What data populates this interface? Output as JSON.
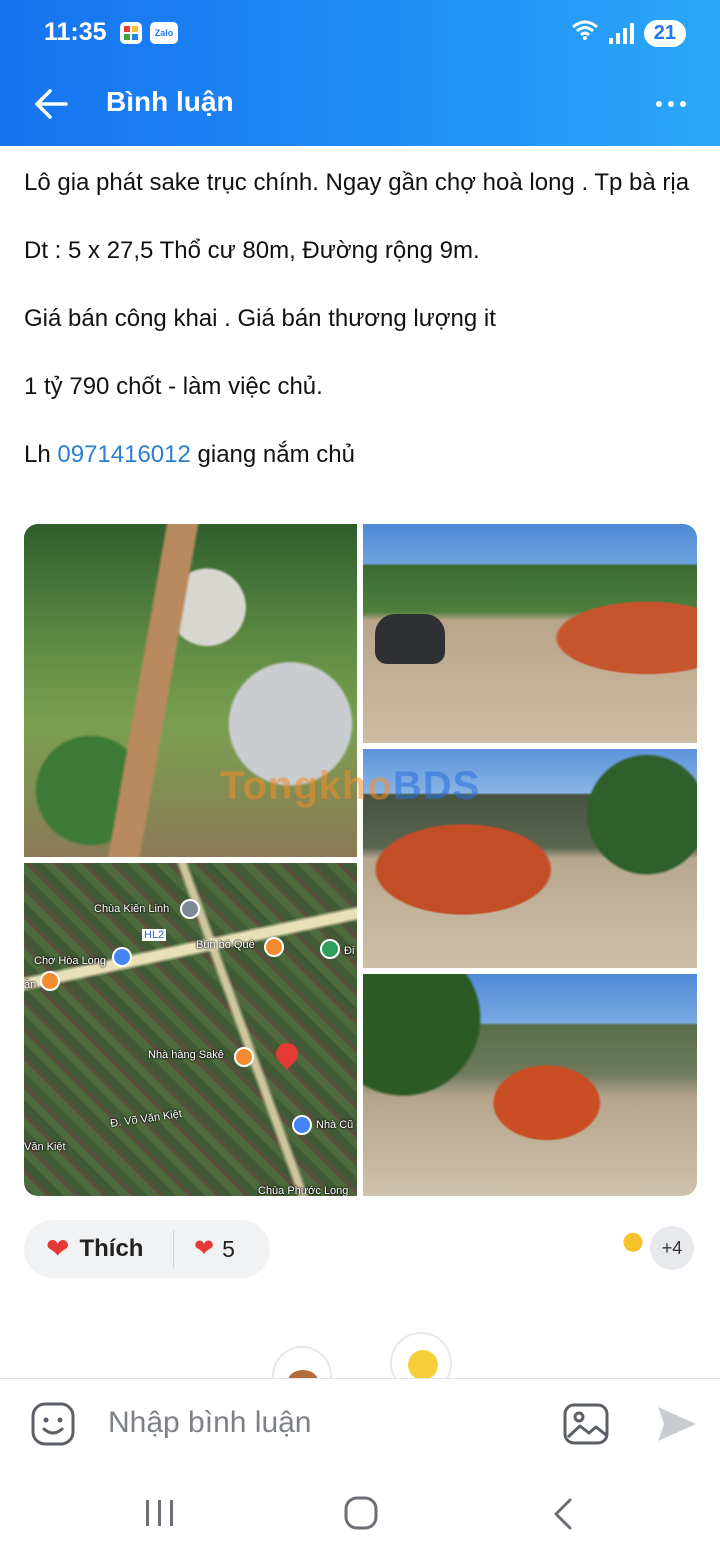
{
  "status_bar": {
    "time": "11:35",
    "app_icons": [
      "apps-icon",
      "zalo-icon"
    ],
    "zalo_label": "Zalo",
    "battery": "21"
  },
  "header": {
    "title": "Bình luận",
    "back_icon": "arrow-left-icon",
    "more_icon": "more-dots-icon"
  },
  "post": {
    "line1": "Lô gia phát sake trục chính. Ngay gần chợ hoà long . Tp bà rịa",
    "line2": "Dt : 5 x 27,5 Thổ cư 80m, Đường rộng 9m.",
    "line3": "Giá bán công khai . Giá bán thương lượng it",
    "line4": "1 tỷ 790 chốt - làm việc chủ.",
    "contact_prefix": "Lh ",
    "phone": "0971416012",
    "contact_suffix": " giang nắm chủ"
  },
  "photos": {
    "watermark_a": "Tongkho",
    "watermark_b": "BDS",
    "map_labels": [
      "Chùa Kiến Linh",
      "HL2",
      "Chợ Hòa Long",
      "Bún bò Quê",
      "Nhà hàng Sakê",
      "Đ. Võ Văn Kiệt",
      "Nhà Cũ",
      "Chùa Phước Long",
      "ăn",
      "Văn Kiệt",
      "Đi"
    ]
  },
  "reactions": {
    "like_label": "Thích",
    "like_count": "5",
    "extra_reactors": "+4",
    "accent": "#e53935"
  },
  "comment_bar": {
    "placeholder": "Nhập bình luận"
  },
  "colors": {
    "header_start": "#1673f0",
    "header_end": "#2aa8f8",
    "link": "#2a7fd4"
  }
}
